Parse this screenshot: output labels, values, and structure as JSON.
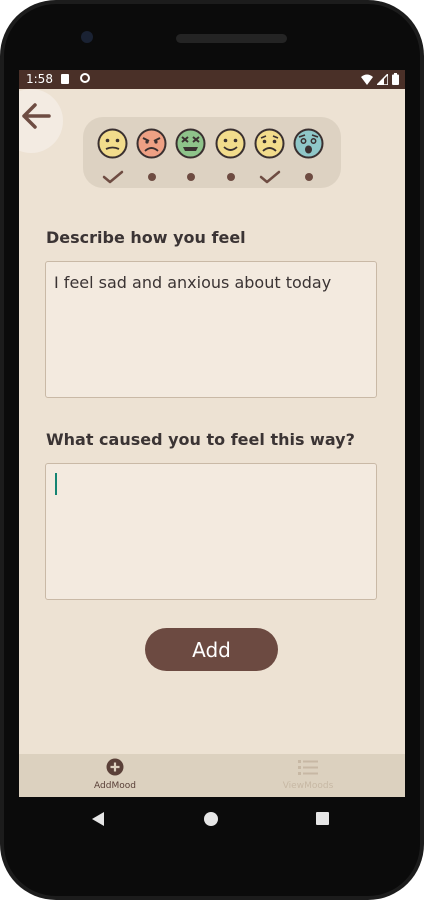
{
  "status": {
    "time": "1:58"
  },
  "moods": [
    {
      "name": "neutral-face",
      "color": "#f2dc8c",
      "selected": true
    },
    {
      "name": "angry-face",
      "color": "#eea084",
      "selected": false
    },
    {
      "name": "disgusted-face",
      "color": "#8ec38a",
      "selected": false
    },
    {
      "name": "happy-face",
      "color": "#f2dc8c",
      "selected": false
    },
    {
      "name": "sad-face",
      "color": "#f2dc8c",
      "selected": true
    },
    {
      "name": "fearful-face",
      "color": "#8fc7c8",
      "selected": false
    }
  ],
  "form": {
    "feel_label": "Describe how you feel",
    "feel_value": "I feel sad and anxious about today",
    "cause_label": "What caused you to feel this way?",
    "cause_value": "",
    "add_label": "Add"
  },
  "bottom_nav": {
    "add_mood_label": "AddMood",
    "view_moods_label": "ViewMoods"
  },
  "colors": {
    "accent": "#6c4a41",
    "background": "#ede2d3",
    "status_bar": "#4a3028"
  }
}
